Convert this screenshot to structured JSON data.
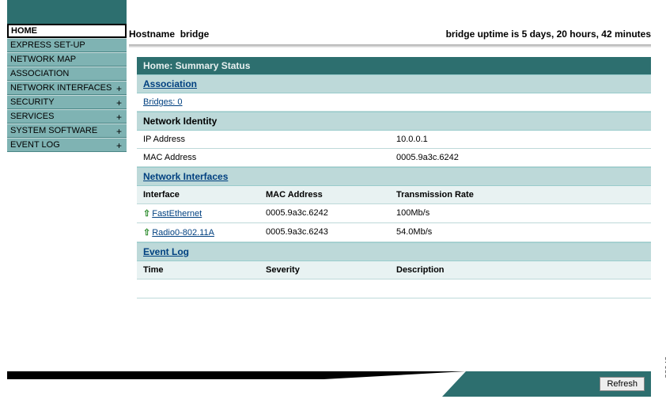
{
  "sidebar": {
    "items": [
      {
        "label": "HOME",
        "active": true,
        "expandable": false
      },
      {
        "label": "EXPRESS SET-UP",
        "active": false,
        "expandable": false
      },
      {
        "label": "NETWORK MAP",
        "active": false,
        "expandable": false
      },
      {
        "label": "ASSOCIATION",
        "active": false,
        "expandable": false
      },
      {
        "label": "NETWORK INTERFACES",
        "active": false,
        "expandable": true
      },
      {
        "label": "SECURITY",
        "active": false,
        "expandable": true
      },
      {
        "label": "SERVICES",
        "active": false,
        "expandable": true
      },
      {
        "label": "SYSTEM SOFTWARE",
        "active": false,
        "expandable": true
      },
      {
        "label": "EVENT LOG",
        "active": false,
        "expandable": true
      }
    ]
  },
  "header": {
    "hostname_label": "Hostname",
    "hostname_value": "bridge",
    "uptime_text": "bridge uptime is 5 days, 20 hours, 42 minutes"
  },
  "panel": {
    "title": "Home: Summary Status",
    "association": {
      "heading": "Association",
      "bridges_label": "Bridges: 0"
    },
    "network_identity": {
      "heading": "Network Identity",
      "ip_label": "IP Address",
      "ip_value": "10.0.0.1",
      "mac_label": "MAC Address",
      "mac_value": "0005.9a3c.6242"
    },
    "network_interfaces": {
      "heading": "Network Interfaces",
      "col_interface": "Interface",
      "col_mac": "MAC Address",
      "col_rate": "Transmission Rate",
      "rows": [
        {
          "name": "FastEthernet",
          "mac": "0005.9a3c.6242",
          "rate": "100Mb/s"
        },
        {
          "name": "Radio0-802.11A",
          "mac": "0005.9a3c.6243",
          "rate": "54.0Mb/s"
        }
      ]
    },
    "event_log": {
      "heading": "Event Log",
      "col_time": "Time",
      "col_severity": "Severity",
      "col_description": "Description"
    }
  },
  "footer": {
    "refresh_label": "Refresh",
    "image_id": "88948"
  }
}
